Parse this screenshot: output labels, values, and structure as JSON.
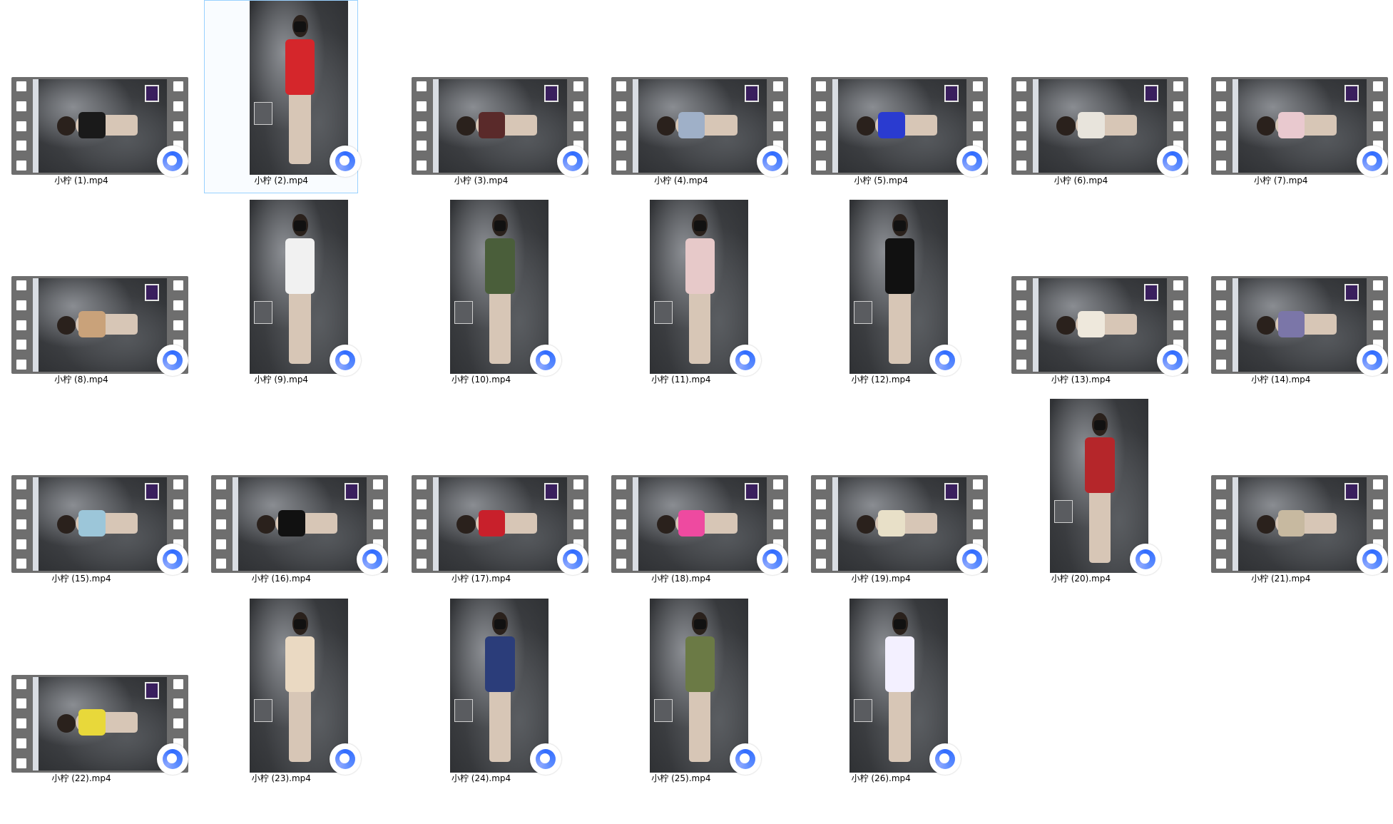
{
  "files": [
    {
      "name": "小柠 (1).mp4",
      "orientation": "landscape",
      "outfit_color": "#1a1a1a"
    },
    {
      "name": "小柠 (2).mp4",
      "orientation": "portrait",
      "outfit_color": "#d5262b",
      "selected": true
    },
    {
      "name": "小柠 (3).mp4",
      "orientation": "landscape",
      "outfit_color": "#5a2a2a"
    },
    {
      "name": "小柠 (4).mp4",
      "orientation": "landscape",
      "outfit_color": "#9fb0c8"
    },
    {
      "name": "小柠 (5).mp4",
      "orientation": "landscape",
      "outfit_color": "#2a3bd0"
    },
    {
      "name": "小柠 (6).mp4",
      "orientation": "landscape",
      "outfit_color": "#e8e4dc"
    },
    {
      "name": "小柠 (7).mp4",
      "orientation": "landscape",
      "outfit_color": "#e9c9cf"
    },
    {
      "name": "小柠 (8).mp4",
      "orientation": "landscape",
      "outfit_color": "#c9a27a"
    },
    {
      "name": "小柠 (9).mp4",
      "orientation": "portrait",
      "outfit_color": "#f1f1f1"
    },
    {
      "name": "小柠 (10).mp4",
      "orientation": "portrait",
      "outfit_color": "#4a5e3a"
    },
    {
      "name": "小柠 (11).mp4",
      "orientation": "portrait",
      "outfit_color": "#e7c9c9"
    },
    {
      "name": "小柠 (12).mp4",
      "orientation": "portrait",
      "outfit_color": "#111111"
    },
    {
      "name": "小柠 (13).mp4",
      "orientation": "landscape",
      "outfit_color": "#eee8dc"
    },
    {
      "name": "小柠 (14).mp4",
      "orientation": "landscape",
      "outfit_color": "#7b76a8"
    },
    {
      "name": "小柠 (15).mp4",
      "orientation": "landscape",
      "outfit_color": "#9cc6d9"
    },
    {
      "name": "小柠 (16).mp4",
      "orientation": "landscape",
      "outfit_color": "#111111"
    },
    {
      "name": "小柠 (17).mp4",
      "orientation": "landscape",
      "outfit_color": "#c8202b"
    },
    {
      "name": "小柠 (18).mp4",
      "orientation": "landscape",
      "outfit_color": "#ee4aa0"
    },
    {
      "name": "小柠 (19).mp4",
      "orientation": "landscape",
      "outfit_color": "#e8e0c8"
    },
    {
      "name": "小柠 (20).mp4",
      "orientation": "portrait",
      "outfit_color": "#b5262a"
    },
    {
      "name": "小柠 (21).mp4",
      "orientation": "landscape",
      "outfit_color": "#c7b9a0"
    },
    {
      "name": "小柠 (22).mp4",
      "orientation": "landscape",
      "outfit_color": "#e8d83a"
    },
    {
      "name": "小柠 (23).mp4",
      "orientation": "portrait",
      "outfit_color": "#ead9c2"
    },
    {
      "name": "小柠 (24).mp4",
      "orientation": "portrait",
      "outfit_color": "#2b3d7a"
    },
    {
      "name": "小柠 (25).mp4",
      "orientation": "portrait",
      "outfit_color": "#6b7a45"
    },
    {
      "name": "小柠 (26).mp4",
      "orientation": "portrait",
      "outfit_color": "#f3f0ff"
    }
  ]
}
